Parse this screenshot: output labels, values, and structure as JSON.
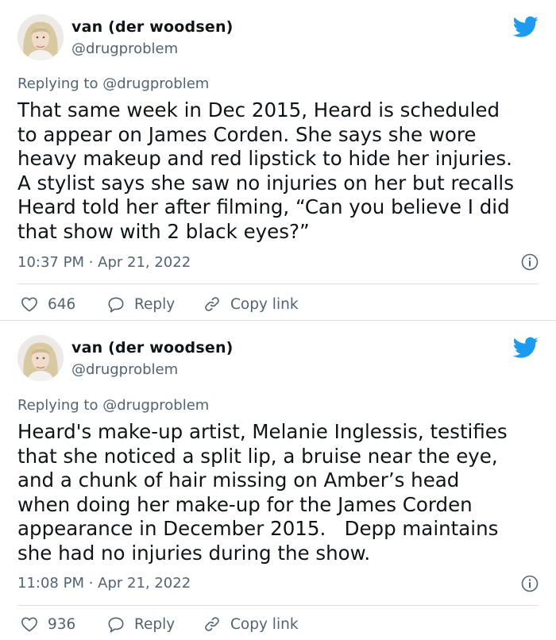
{
  "brand": {
    "twitter_blue": "#1d9bf0",
    "secondary_text": "#536471",
    "primary_text": "#0f1419",
    "divider": "#dcdfe3"
  },
  "tweets": [
    {
      "author": {
        "display_name": "van (der woodsen)",
        "handle": "@drugproblem",
        "avatar_icon": "avatar-photo"
      },
      "replying_prefix": "Replying to ",
      "replying_to": "@drugproblem",
      "text": "That same week in Dec 2015, Heard is scheduled\nto appear on James Corden. She says she wore\nheavy makeup and red lipstick to hide her injuries.\nA stylist says she saw no injuries on her but recalls\nHeard told her after filming, “Can you believe I did\nthat show with 2 black eyes?”",
      "timestamp": "10:37 PM · Apr 21, 2022",
      "actions": {
        "like_count": "646",
        "reply_label": "Reply",
        "copy_link_label": "Copy link"
      }
    },
    {
      "author": {
        "display_name": "van (der woodsen)",
        "handle": "@drugproblem",
        "avatar_icon": "avatar-photo"
      },
      "replying_prefix": "Replying to ",
      "replying_to": "@drugproblem",
      "text": "Heard's make-up artist, Melanie Inglessis, testifies\nthat she noticed a split lip, a bruise near the eye,\nand a chunk of hair missing on Amber’s head\nwhen doing her make-up for the James Corden\nappearance in December 2015.   Depp maintains\nshe had no injuries during the show.",
      "timestamp": "11:08 PM · Apr 21, 2022",
      "actions": {
        "like_count": "936",
        "reply_label": "Reply",
        "copy_link_label": "Copy link"
      }
    }
  ]
}
